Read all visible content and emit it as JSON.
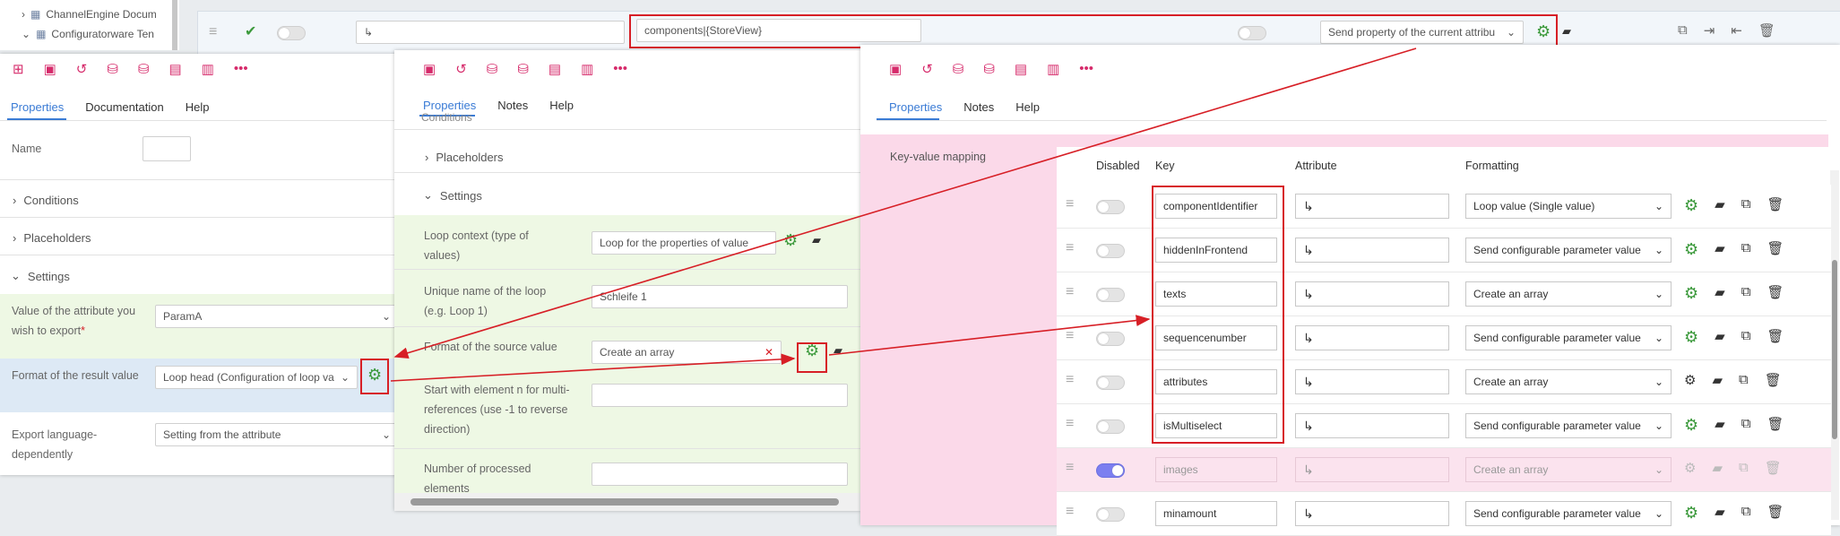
{
  "tree": {
    "items": [
      "ChannelEngine Docum",
      "Configuratorware Ten"
    ]
  },
  "topbar": {
    "components_value": "components|{StoreView}",
    "format_select": "Send property of the current attribu"
  },
  "panel1": {
    "tabs": [
      "Properties",
      "Documentation",
      "Help"
    ],
    "name_label": "Name",
    "sections": [
      "Conditions",
      "Placeholders",
      "Settings"
    ],
    "rows": [
      {
        "label": "Value of the attribute you wish to export",
        "required": "*",
        "value": "ParamA"
      },
      {
        "label": "Format of the result value",
        "value": "Loop head (Configuration of loop va"
      },
      {
        "label": "Export language-dependently",
        "value": "Setting from the attribute"
      }
    ]
  },
  "panel2": {
    "tabs": [
      "Properties",
      "Notes",
      "Help"
    ],
    "cut_section": "Conditions",
    "sections": [
      "Placeholders",
      "Settings"
    ],
    "rows": [
      {
        "label": "Loop context (type of values)",
        "value": "Loop for the properties of value"
      },
      {
        "label": "Unique name of the loop (e.g. Loop 1)",
        "value": "Schleife 1"
      },
      {
        "label": "Format of the source value",
        "value": "Create an array"
      },
      {
        "label": "Start with element n for multi-references (use -1 to reverse direction)",
        "value": ""
      },
      {
        "label": "Number of processed elements",
        "value": ""
      }
    ]
  },
  "panel3": {
    "tabs": [
      "Properties",
      "Notes",
      "Help"
    ],
    "section_label": "Key-value mapping",
    "headers": {
      "disabled": "Disabled",
      "key": "Key",
      "attribute": "Attribute",
      "formatting": "Formatting"
    },
    "rows": [
      {
        "key": "componentIdentifier",
        "formatting": "Loop value (Single value)",
        "disabled": false
      },
      {
        "key": "hiddenInFrontend",
        "formatting": "Send configurable parameter value",
        "disabled": false
      },
      {
        "key": "texts",
        "formatting": "Create an array",
        "disabled": false
      },
      {
        "key": "sequencenumber",
        "formatting": "Send configurable parameter value",
        "disabled": false
      },
      {
        "key": "attributes",
        "formatting": "Create an array",
        "disabled": false
      },
      {
        "key": "isMultiselect",
        "formatting": "Send configurable parameter value",
        "disabled": false
      },
      {
        "key": "images",
        "formatting": "Create an array",
        "disabled": true
      },
      {
        "key": "minamount",
        "formatting": "Send configurable parameter value",
        "disabled": false
      }
    ]
  },
  "colors": {
    "accent": "#d62b6b",
    "tab_active": "#3a7bd5",
    "highlight_red": "#d71f26",
    "green_row": "#eef8e4",
    "blue_row": "#dde9f5",
    "pink_area": "#fbd9e9"
  }
}
